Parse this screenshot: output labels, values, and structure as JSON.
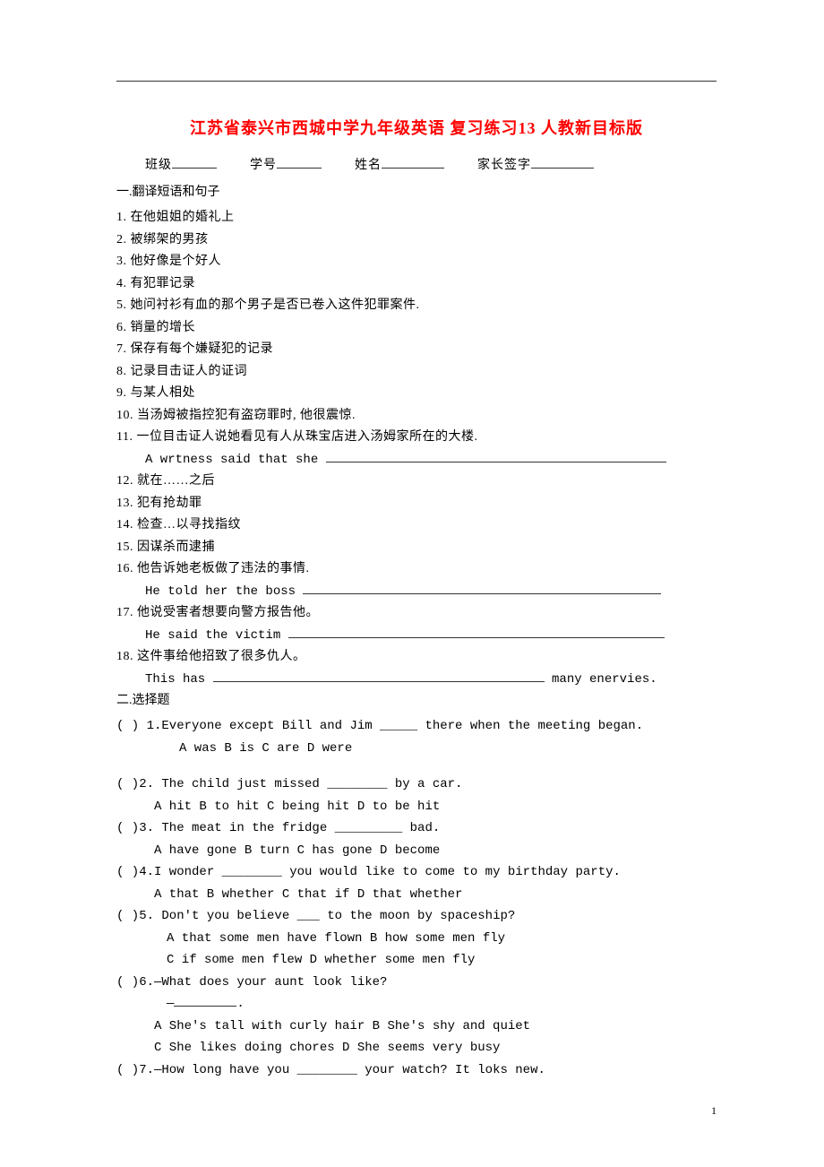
{
  "title": "江苏省泰兴市西城中学九年级英语 复习练习13 人教新目标版",
  "header": {
    "class_label": "班级",
    "id_label": "学号",
    "name_label": "姓名",
    "parent_label": "家长签字"
  },
  "section1": {
    "heading": "一.翻译短语和句子",
    "items": {
      "q1": "1. 在他姐姐的婚礼上",
      "q2": "2. 被绑架的男孩",
      "q3": "3. 他好像是个好人",
      "q4": "4. 有犯罪记录",
      "q5": "5. 她问衬衫有血的那个男子是否已卷入这件犯罪案件.",
      "q6": "6. 销量的增长",
      "q7": "7. 保存有每个嫌疑犯的记录",
      "q8": "8. 记录目击证人的证词",
      "q9": "9. 与某人相处",
      "q10": "10. 当汤姆被指控犯有盗窃罪时, 他很震惊.",
      "q11": "11. 一位目击证人说她看见有人从珠宝店进入汤姆家所在的大楼.",
      "q11_stem": "A wrtness said that she ",
      "q12": "12. 就在……之后",
      "q13": "13. 犯有抢劫罪",
      "q14": "14. 检查…以寻找指纹",
      "q15": "15. 因谋杀而逮捕",
      "q16": "16. 他告诉她老板做了违法的事情.",
      "q16_stem": "He told her the boss ",
      "q17": "17. 他说受害者想要向警方报告他。",
      "q17_stem": "He said the victim ",
      "q18": "18. 这件事给他招致了很多仇人。",
      "q18_stem_a": "This has ",
      "q18_stem_b": " many enervies."
    }
  },
  "section2": {
    "heading": "二.选择题",
    "q1": {
      "paren": "(    ) 1.Everyone except Bill and Jim _____ there when the meeting began.",
      "opts": "A was    B is    C are    D were"
    },
    "q2": {
      "paren": "(   )2. The child just missed ________ by a car.",
      "opts": "A hit     B to hit     C being hit    D to be hit"
    },
    "q3": {
      "paren": "(   )3. The meat in the fridge _________ bad.",
      "opts": "A have gone    B turn     C has gone    D become"
    },
    "q4": {
      "paren": "(   )4.I wonder ________ you would like to come to my birthday party.",
      "opts": "A that    B whether    C that if    D that whether"
    },
    "q5": {
      "paren": "(   )5. Don't you believe ___ to the moon by spaceship?",
      "opts1": "A that some men have flown    B how some men fly",
      "opts2": "C if some men flew           D whether some men fly"
    },
    "q6": {
      "paren": "(   )6.—What does your aunt look like?",
      "dash": "—",
      "period": ".",
      "opts1": "A She's tall with curly hair     B She's shy and quiet",
      "opts2": "C She likes doing chores      D She seems very busy"
    },
    "q7": {
      "paren": "(   )7.—How long have you ________ your watch? It loks new."
    }
  },
  "page_number": "1"
}
